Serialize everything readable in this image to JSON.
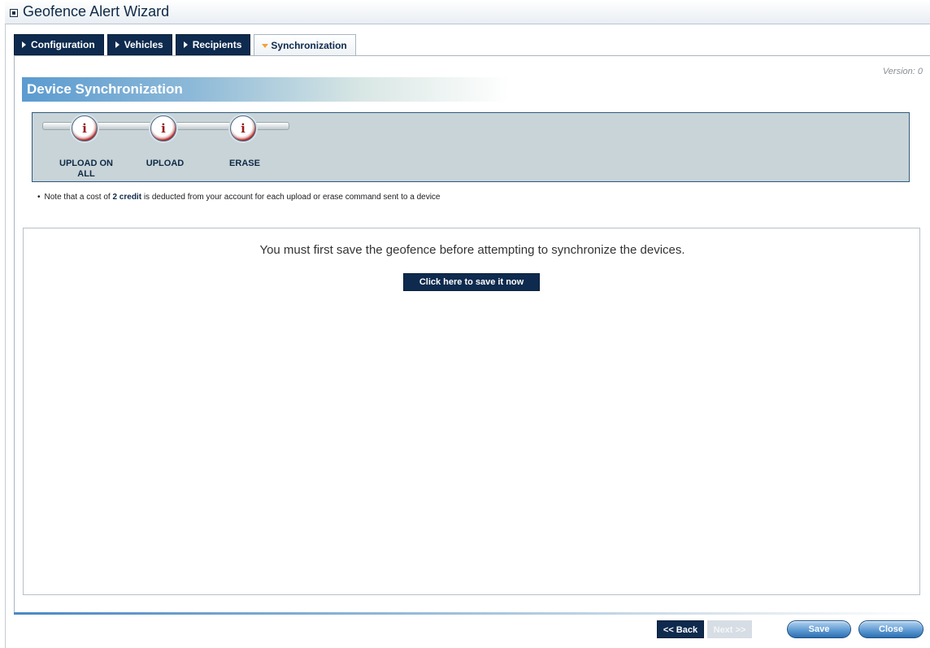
{
  "window": {
    "title": "Geofence Alert Wizard"
  },
  "tabs": [
    {
      "label": "Configuration",
      "active": false
    },
    {
      "label": "Vehicles",
      "active": false
    },
    {
      "label": "Recipients",
      "active": false
    },
    {
      "label": "Synchronization",
      "active": true
    }
  ],
  "version_label": "Version: 0",
  "section": {
    "title": "Device Synchronization"
  },
  "toolbar": {
    "items": [
      {
        "label": "UPLOAD ON ALL",
        "icon": "info-icon"
      },
      {
        "label": "UPLOAD",
        "icon": "info-icon"
      },
      {
        "label": "ERASE",
        "icon": "info-icon"
      }
    ],
    "icon_glyph": "i"
  },
  "note": {
    "bullet": "•",
    "prefix": "Note that a cost of",
    "credit": "2 credit",
    "suffix": "is deducted from your account for each upload or erase command sent to a device"
  },
  "panel": {
    "message": "You must first save the geofence before attempting to synchronize the devices.",
    "save_now_label": "Click here to save it now"
  },
  "footer": {
    "back_label": "<< Back",
    "next_label": "Next >>",
    "save_label": "Save",
    "close_label": "Close"
  },
  "colors": {
    "navy": "#0e2a4e",
    "accent_orange": "#f0a23a",
    "toolbar_bg": "#c8d4d8",
    "header_blue": "#5b9bd0"
  }
}
